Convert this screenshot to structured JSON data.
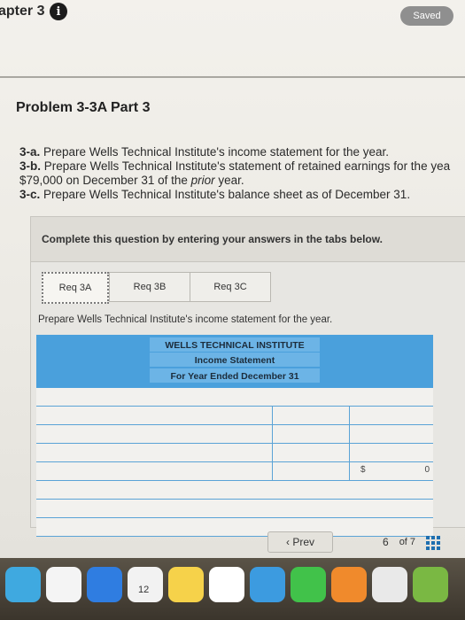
{
  "header": {
    "chapter_title": "apter 3",
    "saved_label": "Saved"
  },
  "problem": {
    "title": "Problem 3-3A Part 3",
    "instructions": [
      {
        "label": "3-a.",
        "text": " Prepare Wells Technical Institute's income statement for the year."
      },
      {
        "label": "3-b.",
        "text": " Prepare Wells Technical Institute's statement of retained earnings for the yea"
      },
      {
        "label": "",
        "text": "$79,000 on December 31 of the ",
        "italic": "prior",
        "after": " year."
      },
      {
        "label": "3-c.",
        "text": " Prepare Wells Technical Institute's balance sheet as of December 31."
      }
    ]
  },
  "panel": {
    "header_text": "Complete this question by entering your answers in the tabs below.",
    "tabs": [
      {
        "label": "Req 3A",
        "active": true
      },
      {
        "label": "Req 3B",
        "active": false
      },
      {
        "label": "Req 3C",
        "active": false
      }
    ],
    "prompt": "Prepare Wells Technical Institute's income statement for the year.",
    "statement": {
      "company": "WELLS TECHNICAL INSTITUTE",
      "name": "Income Statement",
      "period": "For Year Ended December 31"
    },
    "total_row": {
      "currency": "$",
      "value": "0"
    }
  },
  "pager": {
    "prev_label": "Prev",
    "page": "6",
    "of_total": "of 7"
  },
  "dock": {
    "calendar_day": "12",
    "colors": {
      "accent": "#4aa0dc",
      "badge": "#e0392b"
    }
  }
}
